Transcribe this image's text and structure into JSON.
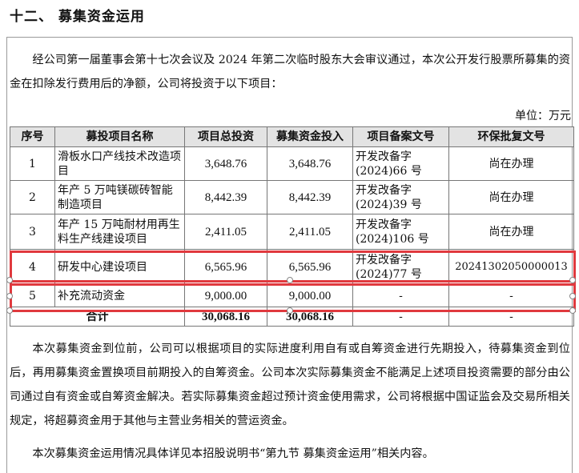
{
  "heading": "十二、  募集资金运用",
  "intro": "经公司第一届董事会第十七次会议及 2024 年第二次临时股东大会审议通过，本次公开发行股票所募集的资金在扣除发行费用后的净额，公司将投资于以下项目：",
  "unit": "单位：万元",
  "table": {
    "headers": [
      "序号",
      "募投项目名称",
      "项目总投资",
      "募集资金投入",
      "项目备案文号",
      "环保批复文号"
    ],
    "rows": [
      {
        "no": "1",
        "name": "滑板水口产线技术改造项目",
        "total": "3,648.76",
        "raised": "3,648.76",
        "filing": "开发改备字(2024)66 号",
        "env": "尚在办理"
      },
      {
        "no": "2",
        "name": "年产 5 万吨镁碳砖智能制造项目",
        "total": "8,442.39",
        "raised": "8,442.39",
        "filing": "开发改备字(2024)39 号",
        "env": "尚在办理"
      },
      {
        "no": "3",
        "name": "年产 15 万吨耐材用再生料生产线建设项目",
        "total": "2,411.05",
        "raised": "2,411.05",
        "filing": "开发改备字(2024)106 号",
        "env": "尚在办理"
      },
      {
        "no": "4",
        "name": "研发中心建设项目",
        "total": "6,565.96",
        "raised": "6,565.96",
        "filing": "开发改备字(2024)77 号",
        "env": "20241302050000013"
      },
      {
        "no": "5",
        "name": "补充流动资金",
        "total": "9,000.00",
        "raised": "9,000.00",
        "filing": "-",
        "env": "-"
      }
    ],
    "total_row": {
      "label": "合计",
      "total": "30,068.16",
      "raised": "30,068.16",
      "filing": "-",
      "env": "-"
    }
  },
  "para2": "本次募集资金到位前，公司可以根据项目的实际进度利用自有或自筹资金进行先期投入，待募集资金到位后，再用募集资金置换项目前期投入的自筹资金。公司本次实际募集资金不能满足上述项目投资需要的部分由公司通过自有资金或自筹资金解决。若实际募集资金超过预计资金使用需求，公司将根据中国证监会及交易所相关规定，将超募资金用于其他与主营业务相关的营运资金。",
  "para3": "本次募集资金运用情况具体详见本招股说明书“第九节 募集资金运用”相关内容。",
  "colors": {
    "highlight": "#e0393e",
    "header_bg": "#e3e3e3",
    "border": "#777777"
  }
}
